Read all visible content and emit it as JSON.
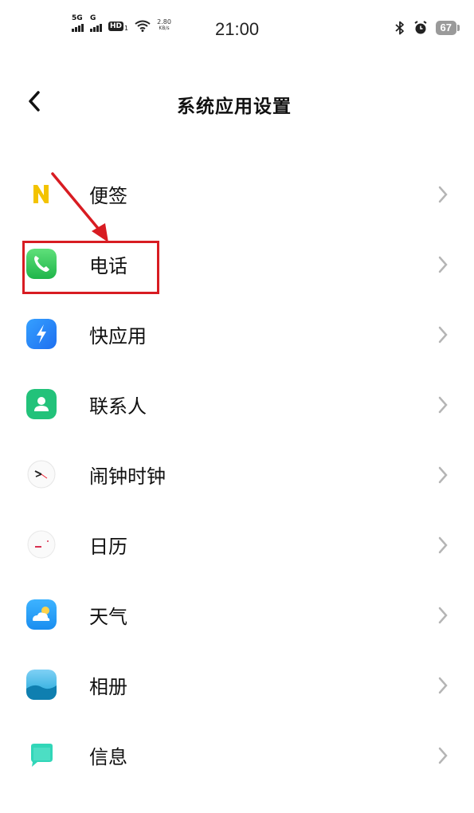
{
  "status_bar": {
    "network1": "5G",
    "network2": "G",
    "hd": "HD",
    "hd_sub": "1",
    "speed_value": "2.80",
    "speed_unit": "KB/s",
    "time": "21:00",
    "battery": "67"
  },
  "header": {
    "title": "系统应用设置"
  },
  "items": [
    {
      "label": "便签",
      "icon": "notes-icon"
    },
    {
      "label": "电话",
      "icon": "phone-icon"
    },
    {
      "label": "快应用",
      "icon": "quick-app-icon"
    },
    {
      "label": "联系人",
      "icon": "contacts-icon"
    },
    {
      "label": "闹钟时钟",
      "icon": "clock-icon"
    },
    {
      "label": "日历",
      "icon": "calendar-icon"
    },
    {
      "label": "天气",
      "icon": "weather-icon"
    },
    {
      "label": "相册",
      "icon": "gallery-icon"
    },
    {
      "label": "信息",
      "icon": "messages-icon"
    }
  ],
  "annotation": {
    "highlight_color": "#d81c22",
    "highlighted_item": "电话"
  }
}
